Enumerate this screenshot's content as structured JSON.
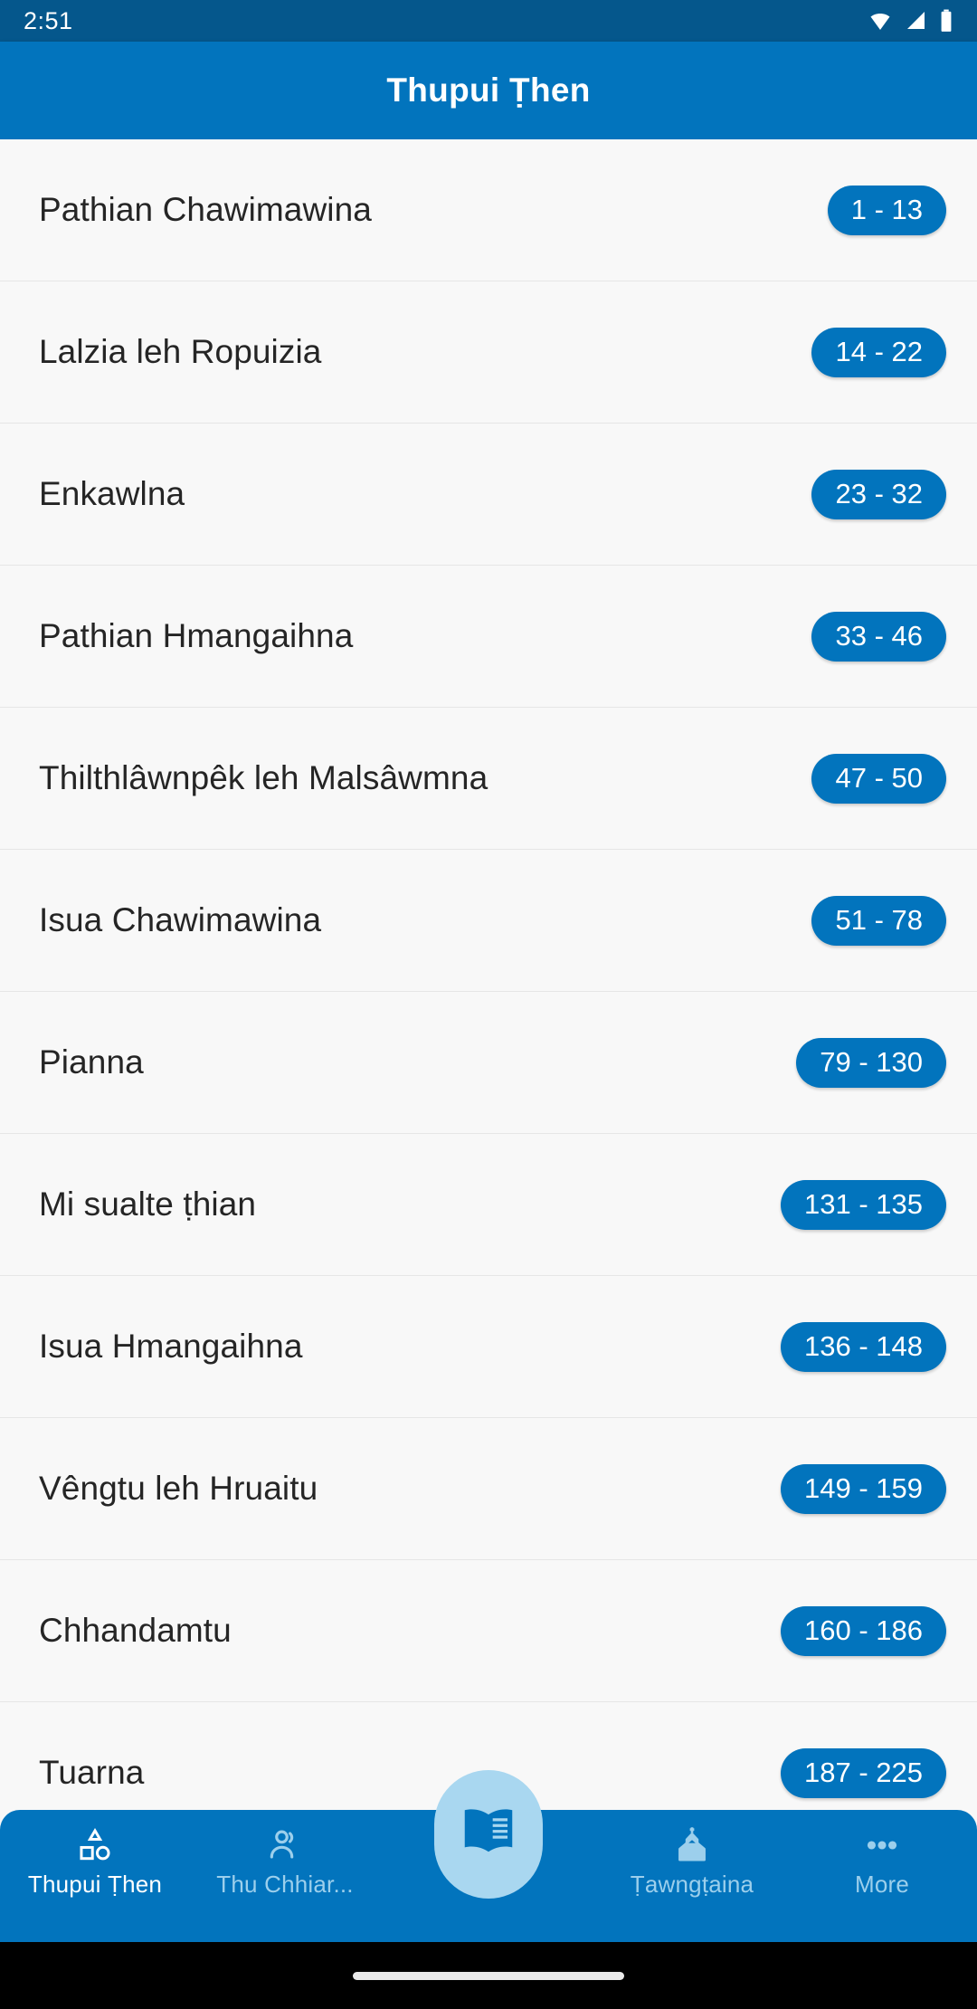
{
  "status_bar": {
    "clock": "2:51",
    "icons": [
      "wifi-icon",
      "signal-icon",
      "battery-icon"
    ]
  },
  "app_bar": {
    "title": "Thupui Ṭhen"
  },
  "colors": {
    "status_bar": "#05578C",
    "app_bar": "#0274BD",
    "chip": "#0274BD",
    "chip_text": "#ffffff",
    "list_background": "#f8f8f8",
    "row_title": "#252525",
    "nav_background": "#0274BD",
    "nav_active": "#ffffff",
    "nav_inactive": "#9CCFEC",
    "fab_background": "#A9D7F0"
  },
  "list": {
    "rows": [
      {
        "title": "Pathian Chawimawina",
        "range": "1 - 13"
      },
      {
        "title": "Lalzia leh Ropuizia",
        "range": "14 - 22"
      },
      {
        "title": "Enkawlna",
        "range": "23 - 32"
      },
      {
        "title": "Pathian Hmangaihna",
        "range": "33 - 46"
      },
      {
        "title": "Thilthlâwnpêk leh Malsâwmna",
        "range": "47 - 50"
      },
      {
        "title": "Isua Chawimawina",
        "range": "51 - 78"
      },
      {
        "title": "Pianna",
        "range": "79 - 130"
      },
      {
        "title": "Mi sualte ṭhian",
        "range": "131 - 135"
      },
      {
        "title": "Isua Hmangaihna",
        "range": "136 - 148"
      },
      {
        "title": "Vêngtu leh Hruaitu",
        "range": "149 - 159"
      },
      {
        "title": "Chhandamtu",
        "range": "160 - 186"
      },
      {
        "title": "Tuarna",
        "range": "187 - 225"
      }
    ]
  },
  "bottom_nav": {
    "items": [
      {
        "label": "Thupui Ṭhen",
        "icon": "shapes-icon",
        "active": true
      },
      {
        "label": "Thu Chhiar...",
        "icon": "people-icon",
        "active": false
      },
      {
        "label": "Ṭawngṭaina",
        "icon": "church-icon",
        "active": false
      },
      {
        "label": "More",
        "icon": "more-dots-icon",
        "active": false
      }
    ],
    "fab": {
      "icon": "open-book-icon"
    }
  }
}
